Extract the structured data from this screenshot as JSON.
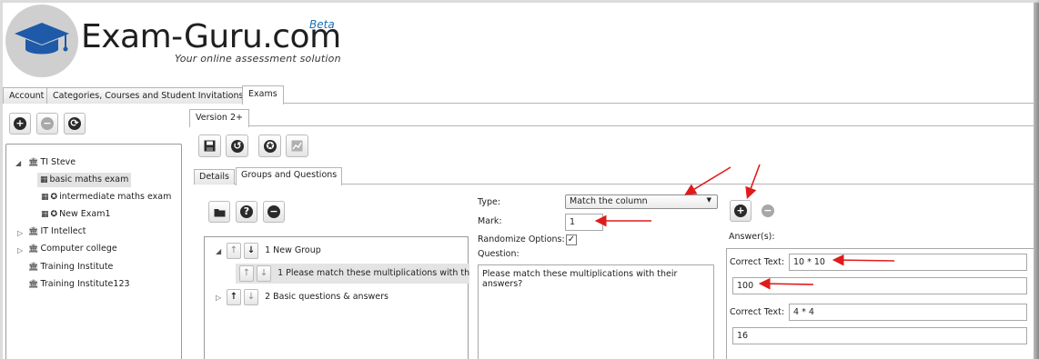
{
  "brand": {
    "name": "Exam-Guru.com",
    "beta": "Beta",
    "tagline": "Your online assessment solution"
  },
  "top_tabs": [
    {
      "label": "Account"
    },
    {
      "label": "Categories, Courses and Student Invitations"
    },
    {
      "label": "Exams"
    }
  ],
  "tree": {
    "root": "TI Steve",
    "children": [
      {
        "label": "basic maths exam"
      },
      {
        "label": "intermediate maths exam"
      },
      {
        "label": "New Exam1"
      }
    ],
    "others": [
      {
        "label": "IT Intellect"
      },
      {
        "label": "Computer college"
      },
      {
        "label": "Training Institute"
      },
      {
        "label": "Training Institute123"
      }
    ]
  },
  "version_tab": "Version 2+",
  "sub_tabs": [
    {
      "label": "Details"
    },
    {
      "label": "Groups and Questions"
    }
  ],
  "groups": {
    "group1": "1 New Group",
    "question1": "1 Please match these multiplications with the",
    "group2": "2 Basic questions & answers"
  },
  "form": {
    "type_label": "Type:",
    "type_value": "Match the column",
    "mark_label": "Mark:",
    "mark_value": "1",
    "randomize_label": "Randomize Options:",
    "randomize_checked": "✓",
    "question_label": "Question:",
    "question_value": "Please match these multiplications with their answers?"
  },
  "answers": {
    "label": "Answer(s):",
    "correct_label": "Correct Text:",
    "rows": [
      {
        "correct": "10 * 10",
        "match": "100"
      },
      {
        "correct": "4 * 4",
        "match": "16"
      }
    ]
  },
  "colors": {
    "annotation_arrow": "#e01b1b",
    "beta": "#1a6fb8"
  }
}
